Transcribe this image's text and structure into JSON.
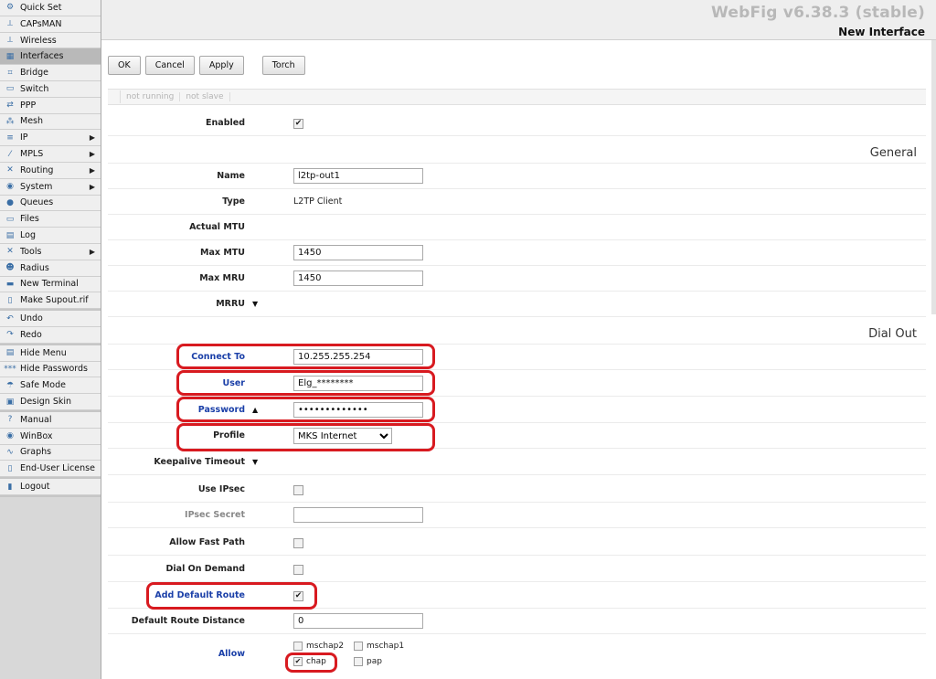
{
  "app": {
    "brand": "WebFig v6.38.3 (stable)",
    "page_title": "New Interface"
  },
  "sidebar": {
    "groups": [
      [
        {
          "label": "Quick Set",
          "icon": "quick-set-icon"
        },
        {
          "label": "CAPsMAN",
          "icon": "capsman-icon"
        },
        {
          "label": "Wireless",
          "icon": "wireless-icon"
        },
        {
          "label": "Interfaces",
          "icon": "interfaces-icon",
          "active": true
        },
        {
          "label": "Bridge",
          "icon": "bridge-icon"
        },
        {
          "label": "Switch",
          "icon": "switch-icon"
        },
        {
          "label": "PPP",
          "icon": "ppp-icon"
        },
        {
          "label": "Mesh",
          "icon": "mesh-icon"
        },
        {
          "label": "IP",
          "icon": "ip-icon",
          "submenu": true
        },
        {
          "label": "MPLS",
          "icon": "mpls-icon",
          "submenu": true
        },
        {
          "label": "Routing",
          "icon": "routing-icon",
          "submenu": true
        },
        {
          "label": "System",
          "icon": "system-icon",
          "submenu": true
        },
        {
          "label": "Queues",
          "icon": "queues-icon"
        },
        {
          "label": "Files",
          "icon": "files-icon"
        },
        {
          "label": "Log",
          "icon": "log-icon"
        },
        {
          "label": "Tools",
          "icon": "tools-icon",
          "submenu": true
        },
        {
          "label": "Radius",
          "icon": "radius-icon"
        },
        {
          "label": "New Terminal",
          "icon": "terminal-icon"
        },
        {
          "label": "Make Supout.rif",
          "icon": "supout-icon"
        }
      ],
      [
        {
          "label": "Undo",
          "icon": "undo-icon"
        },
        {
          "label": "Redo",
          "icon": "redo-icon"
        }
      ],
      [
        {
          "label": "Hide Menu",
          "icon": "hide-menu-icon"
        },
        {
          "label": "Hide Passwords",
          "icon": "hide-passwords-icon"
        },
        {
          "label": "Safe Mode",
          "icon": "safe-mode-icon"
        },
        {
          "label": "Design Skin",
          "icon": "design-skin-icon"
        }
      ],
      [
        {
          "label": "Manual",
          "icon": "manual-icon"
        },
        {
          "label": "WinBox",
          "icon": "winbox-icon"
        },
        {
          "label": "Graphs",
          "icon": "graphs-icon"
        },
        {
          "label": "End-User License",
          "icon": "license-icon"
        }
      ],
      [
        {
          "label": "Logout",
          "icon": "logout-icon"
        }
      ]
    ]
  },
  "toolbar": {
    "ok": "OK",
    "cancel": "Cancel",
    "apply": "Apply",
    "torch": "Torch"
  },
  "status": {
    "running": "not running",
    "slave": "not slave"
  },
  "form": {
    "enabled": {
      "label": "Enabled",
      "checked": true
    },
    "general_title": "General",
    "name": {
      "label": "Name",
      "value": "l2tp-out1"
    },
    "type": {
      "label": "Type",
      "value": "L2TP Client"
    },
    "actual_mtu": {
      "label": "Actual MTU"
    },
    "max_mtu": {
      "label": "Max MTU",
      "value": "1450"
    },
    "max_mru": {
      "label": "Max MRU",
      "value": "1450"
    },
    "mrru": {
      "label": "MRRU"
    },
    "dial_out_title": "Dial Out",
    "connect_to": {
      "label": "Connect To",
      "value": "10.255.255.254"
    },
    "user": {
      "label": "User",
      "value": "Elg_********"
    },
    "password": {
      "label": "Password",
      "value": "•••••••••••••"
    },
    "profile": {
      "label": "Profile",
      "value": "MKS Internet"
    },
    "keepalive": {
      "label": "Keepalive Timeout"
    },
    "use_ipsec": {
      "label": "Use IPsec",
      "checked": false
    },
    "ipsec_secret": {
      "label": "IPsec Secret",
      "value": ""
    },
    "allow_fast_path": {
      "label": "Allow Fast Path",
      "checked": false
    },
    "dial_on_demand": {
      "label": "Dial On Demand",
      "checked": false
    },
    "add_default_route": {
      "label": "Add Default Route",
      "checked": true
    },
    "default_route_distance": {
      "label": "Default Route Distance",
      "value": "0"
    },
    "allow": {
      "label": "Allow",
      "options": [
        {
          "label": "mschap2",
          "checked": false
        },
        {
          "label": "mschap1",
          "checked": false
        },
        {
          "label": "chap",
          "checked": true
        },
        {
          "label": "pap",
          "checked": false
        }
      ]
    }
  },
  "colors": {
    "highlight": "#d81a20",
    "label_blue": "#1a3fa8"
  }
}
